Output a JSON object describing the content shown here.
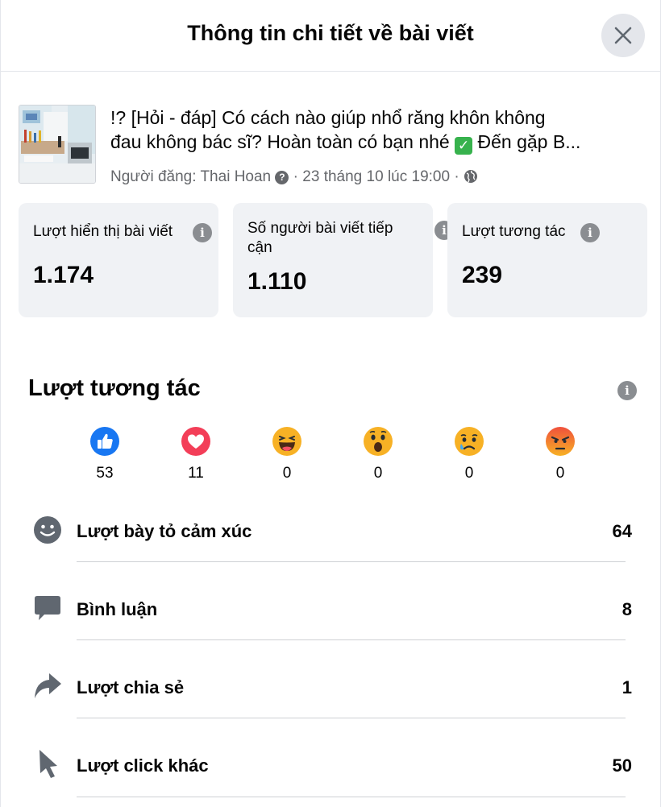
{
  "header": {
    "title": "Thông tin chi tiết về bài viết",
    "close_icon": "close-icon"
  },
  "post": {
    "title_line1": "!? [Hỏi - đáp] Có cách nào giúp nhổ răng khôn không",
    "title_line2_a": "đau không bác sĩ? Hoàn toàn có bạn nhé ",
    "title_line2_emoji": "✓",
    "title_line2_b": " Đến gặp B...",
    "meta_author": "Người đăng: Thai Hoan",
    "meta_help_icon": "?",
    "meta_date": " · 23 tháng 10 lúc 19:00 · ",
    "meta_globe_icon": "globe-icon"
  },
  "stats": [
    {
      "label": "Lượt hiển thị bài viết",
      "value": "1.174"
    },
    {
      "label_line1": "Số người bài viết tiếp",
      "label_line2": "cận",
      "value": "1.110"
    },
    {
      "label": "Lượt tương tác",
      "value": "239"
    }
  ],
  "info_glyph": "i",
  "engagement": {
    "title": "Lượt tương tác",
    "reactions": [
      {
        "icon": "like-icon",
        "count": "53",
        "color": "#1877f2"
      },
      {
        "icon": "love-icon",
        "count": "11",
        "color": "#f33e58"
      },
      {
        "icon": "haha-icon",
        "count": "0",
        "color": "#f7b125"
      },
      {
        "icon": "wow-icon",
        "count": "0",
        "color": "#f7b125"
      },
      {
        "icon": "sad-icon",
        "count": "0",
        "color": "#f7b125"
      },
      {
        "icon": "angry-icon",
        "count": "0",
        "color": "#e9710f"
      }
    ],
    "metrics": [
      {
        "icon": "smiley-icon",
        "label": "Lượt bày tỏ cảm xúc",
        "value": "64"
      },
      {
        "icon": "comment-icon",
        "label": "Bình luận",
        "value": "8"
      },
      {
        "icon": "share-icon",
        "label": "Lượt chia sẻ",
        "value": "1"
      },
      {
        "icon": "cursor-icon",
        "label": "Lượt click khác",
        "value": "50"
      }
    ]
  }
}
